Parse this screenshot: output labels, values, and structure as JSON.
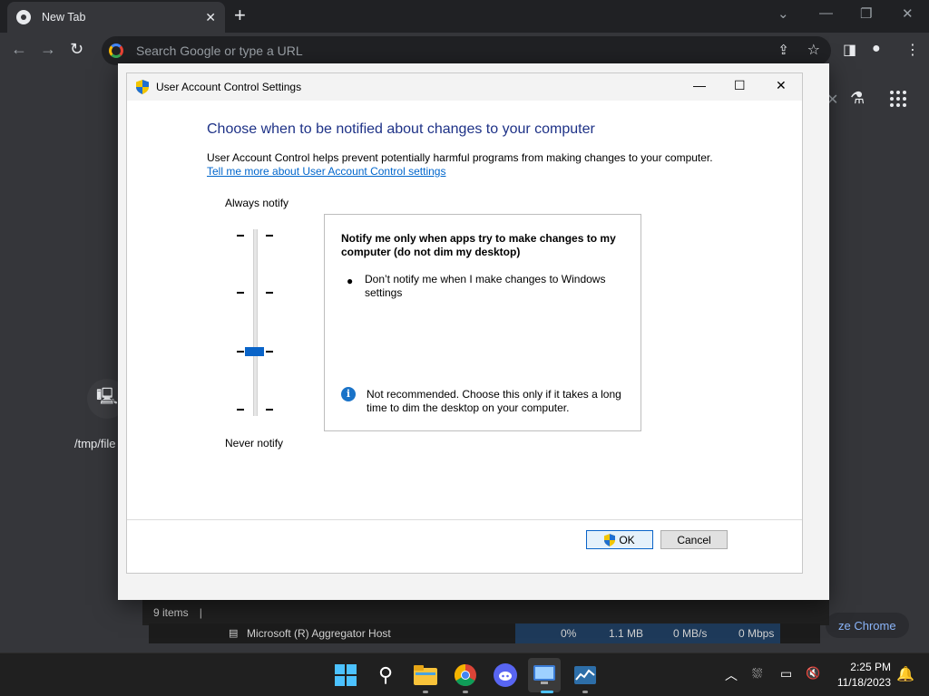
{
  "browser": {
    "tab_title": "New Tab",
    "tab_close": "✕",
    "new_tab": "+",
    "omnibox_placeholder": "Search Google or type a URL",
    "window_controls": {
      "chevron": "⌄",
      "minimize": "—",
      "restore": "❐",
      "close": "✕"
    }
  },
  "uac": {
    "window_title": "User Account Control Settings",
    "heading": "Choose when to be notified about changes to your computer",
    "description": "User Account Control helps prevent potentially harmful programs from making changes to your computer.",
    "link": "Tell me more about User Account Control settings",
    "slider_top_label": "Always notify",
    "slider_bottom_label": "Never notify",
    "slider_level": 3,
    "slider_levels_total": 4,
    "info_title": "Notify me only when apps try to make changes to my computer (do not dim my desktop)",
    "bullet": "Don’t notify me when I make changes to Windows settings",
    "warning": "Not recommended. Choose this only if it takes a long time to dim the desktop on your computer.",
    "ok_label": "OK",
    "cancel_label": "Cancel",
    "accent": "#0a64c8"
  },
  "background": {
    "explorer_status": "9 items",
    "process_name": "Microsoft (R) Aggregator Host",
    "cpu": "0%",
    "memory": "1.1 MB",
    "disk": "0 MB/s",
    "network": "0 Mbps",
    "desktop_label": "/tmp/file",
    "customize_label": "ze Chrome"
  },
  "taskbar": {
    "time": "2:25 PM",
    "date": "11/18/2023"
  }
}
